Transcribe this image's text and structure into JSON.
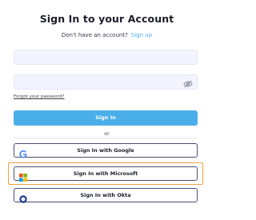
{
  "header": {
    "title": "Sign In to your Account",
    "prompt": "Don't have an account?",
    "signup_link": "Sign up"
  },
  "form": {
    "email": {
      "value": "",
      "placeholder": ""
    },
    "password": {
      "value": "",
      "placeholder": ""
    },
    "password_toggle_icon": "eye-off-icon",
    "forgot_link": "Forgot your password?",
    "signin_label": "Sign In"
  },
  "separator": {
    "label": "or"
  },
  "sso": {
    "google": {
      "label": "Sign In with Google",
      "icon": "google-icon"
    },
    "microsoft": {
      "label": "Sign In with Microsoft",
      "icon": "microsoft-icon"
    },
    "okta": {
      "label": "Sign In with Okta",
      "icon": "okta-icon"
    }
  },
  "colors": {
    "accent": "#4aaee8",
    "input_bg": "#f3f4fd",
    "button_border": "#4a4f72",
    "highlight": "#f2a03c"
  }
}
